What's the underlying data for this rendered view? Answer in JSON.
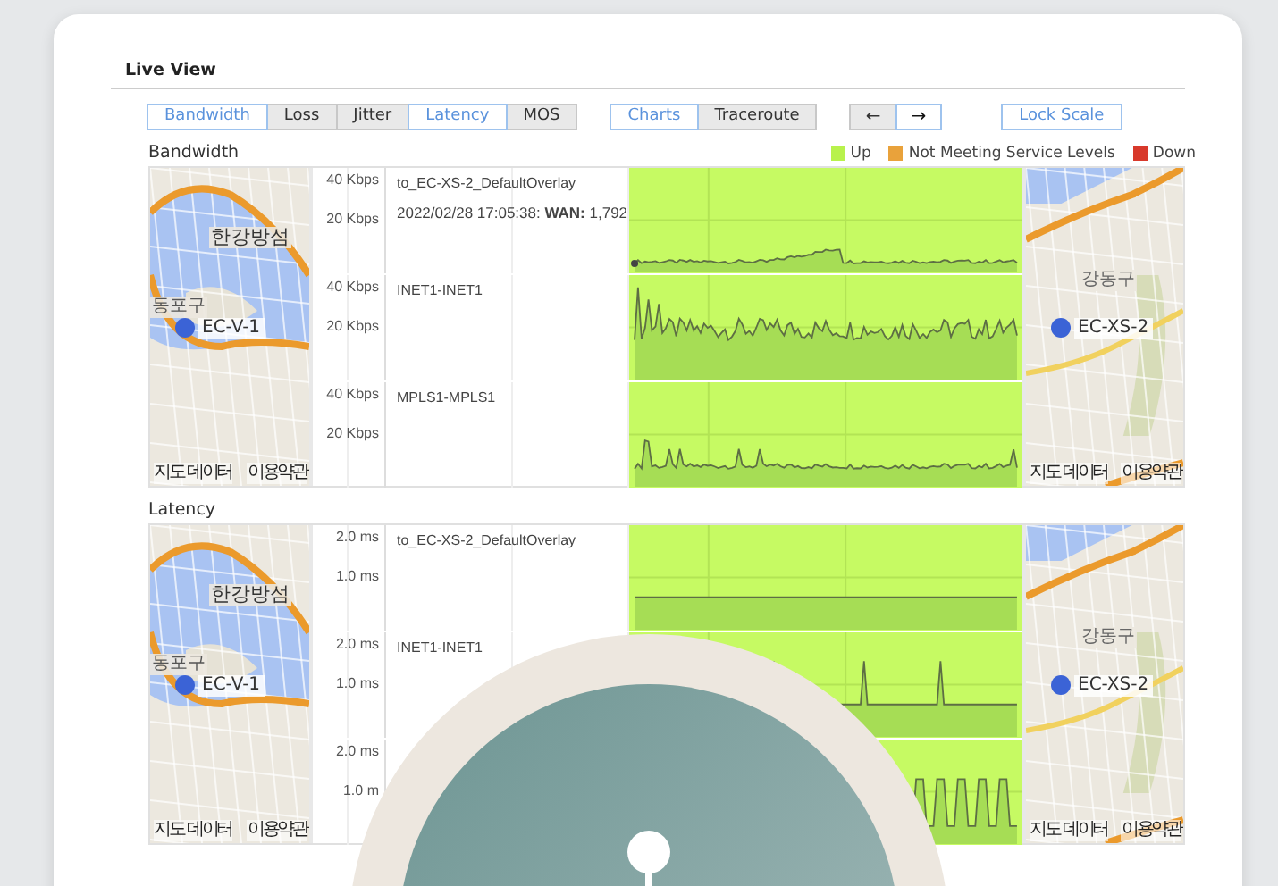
{
  "header": {
    "title": "Live View"
  },
  "toolbar": {
    "metric_tabs": [
      {
        "label": "Bandwidth",
        "selected": true
      },
      {
        "label": "Loss",
        "selected": false
      },
      {
        "label": "Jitter",
        "selected": false
      },
      {
        "label": "Latency",
        "selected": true
      },
      {
        "label": "MOS",
        "selected": false
      }
    ],
    "view_tabs": [
      {
        "label": "Charts",
        "selected": true
      },
      {
        "label": "Traceroute",
        "selected": false
      }
    ],
    "nav_buttons": [
      {
        "label": "←",
        "selected": false
      },
      {
        "label": "→",
        "selected": true
      }
    ],
    "lock_button": "Lock Scale"
  },
  "legend": [
    {
      "label": "Up",
      "color": "#b8f24c"
    },
    {
      "label": "Not Meeting Service Levels",
      "color": "#e9a23b"
    },
    {
      "label": "Down",
      "color": "#d8392b"
    }
  ],
  "sections": [
    {
      "title": "Bandwidth",
      "left_map": {
        "place": "한강방섬",
        "district": "동포구",
        "site": "EC-V-1",
        "attribution": "지도 데이터",
        "terms": "이용약관"
      },
      "right_map": {
        "district": "강동구",
        "site": "EC-XS-2",
        "attribution": "지도 데이터",
        "terms": "이용약관"
      },
      "rows": [
        {
          "label": "to_EC-XS-2_DefaultOverlay",
          "tooltip": "2022/02/28 17:05:38: **WAN:** 1,792",
          "ticks": [
            "40 Kbps",
            "20 Kbps"
          ],
          "kind": "flat"
        },
        {
          "label": "INET1-INET1",
          "ticks": [
            "40 Kbps",
            "20 Kbps"
          ],
          "kind": "noisy"
        },
        {
          "label": "MPLS1-MPLS1",
          "ticks": [
            "40 Kbps",
            "20 Kbps"
          ],
          "kind": "quiet"
        }
      ]
    },
    {
      "title": "Latency",
      "left_map": {
        "place": "한강방섬",
        "district": "동포구",
        "site": "EC-V-1",
        "attribution": "지도 데이터",
        "terms": "이용약관"
      },
      "right_map": {
        "district": "강동구",
        "site": "EC-XS-2",
        "attribution": "지도 데이터",
        "terms": "이용약관"
      },
      "rows": [
        {
          "label": "to_EC-XS-2_DefaultOverlay",
          "ticks": [
            "2.0 ms",
            "1.0 ms"
          ],
          "kind": "line"
        },
        {
          "label": "INET1-INET1",
          "ticks": [
            "2.0 ms",
            "1.0 ms"
          ],
          "kind": "pulses"
        },
        {
          "ticks": [
            "2.0 ms",
            "1.0 m"
          ],
          "kind": "square"
        }
      ]
    }
  ]
}
